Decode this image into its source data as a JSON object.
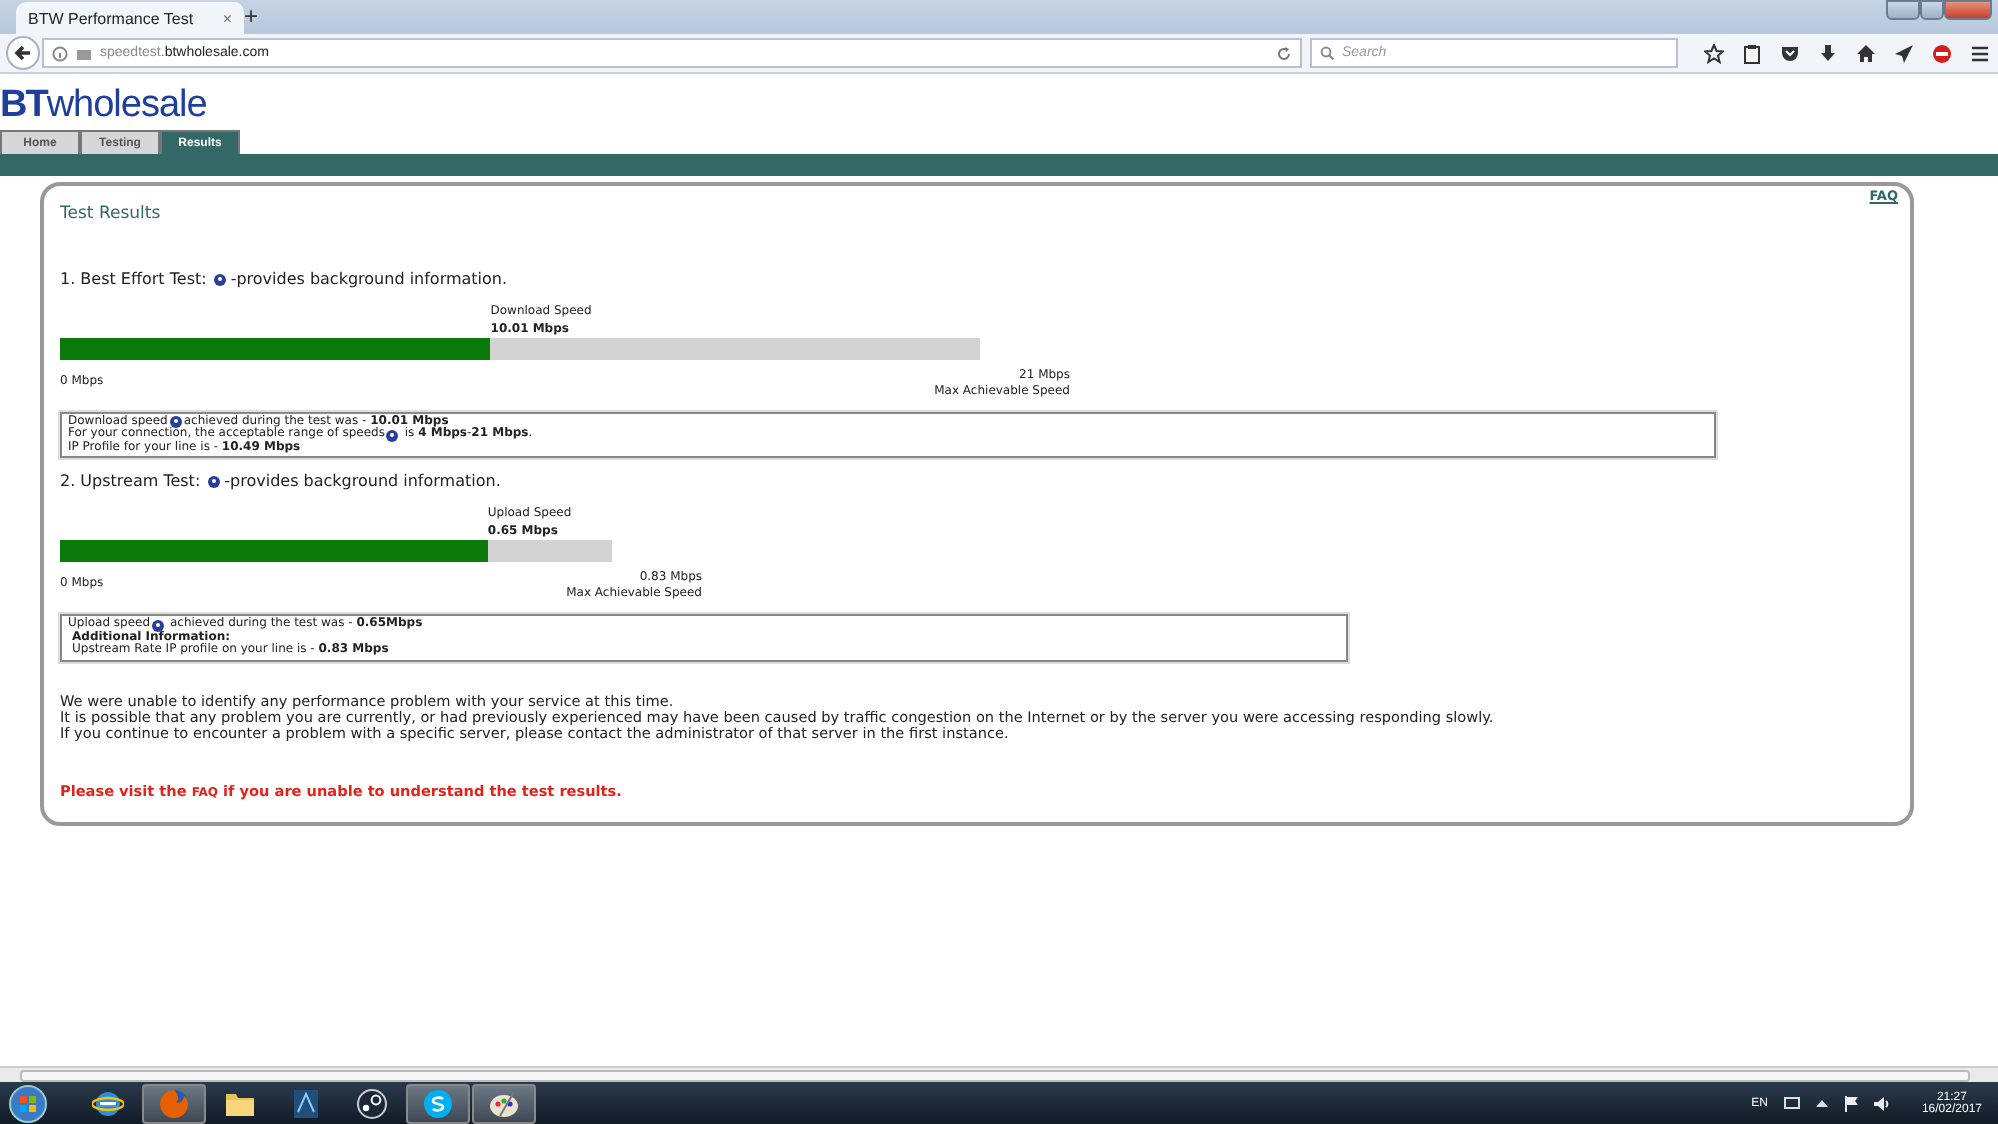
{
  "browser": {
    "tab_title": "BTW Performance Test",
    "close_tab": "×",
    "new_tab": "+",
    "url": "speedtest.**btwholesale.com**",
    "search_placeholder": "Search"
  },
  "site": {
    "logo_bold": "BT",
    "logo_rest": "wholesale",
    "nav_tabs": [
      {
        "label": "Home",
        "selected": false
      },
      {
        "label": "Testing",
        "selected": false
      },
      {
        "label": "Results",
        "selected": true
      }
    ]
  },
  "panel": {
    "faq_link": "FAQ",
    "title": "Test Results",
    "tests": [
      {
        "heading": "1. Best Effort Test:",
        "note": "-provides background information.",
        "meter_label": "Download  Speed",
        "meter_value": "10.01 Mbps",
        "level": 0.468,
        "min": "0 Mbps",
        "max": "21 Mbps",
        "max_label": "Max Achievable Speed",
        "info_lines": [
          {
            "before": "Download speed",
            "help_icon": true,
            "after": "achieved during the test was - **10.01 Mbps**",
            "bold": false
          },
          {
            "before": "For your connection, the acceptable range of speeds",
            "help_icon": true,
            "after": " is **4 Mbps**-**21 Mbps**.",
            "bold": false
          },
          {
            "before": "IP Profile for your line is - **10.49 Mbps**",
            "help_icon": false,
            "bold": false
          }
        ]
      },
      {
        "heading": "2. Upstream Test:",
        "note": "-provides background information.",
        "meter_label": "Upload Speed",
        "meter_value": "0.65 Mbps",
        "level": 0.775,
        "min": "0 Mbps",
        "max": "0.83 Mbps",
        "max_label": "Max Achievable Speed",
        "info_lines": [
          {
            "before": "Upload speed",
            "help_icon": true,
            "after": " achieved during the test was - **0.65Mbps**",
            "bold": false
          },
          {
            "before": "Additional Information:",
            "help_icon": false,
            "bold": true
          },
          {
            "before": "Upstream Rate IP profile on your line is - **0.83 Mbps**",
            "help_icon": false,
            "bold": false
          }
        ]
      }
    ],
    "messages": [
      "We were unable to identify any performance problem with your service at this time.",
      "It is possible that any problem you are currently, or had previously experienced may have been caused by traffic congestion on the Internet or by the server you were accessing responding slowly.",
      "If you continue to encounter a problem with a specific server, please contact the administrator of that server in the first instance."
    ],
    "notice_before": "Please visit the",
    "notice_link": "FAQ",
    "notice_after": "if you are unable to understand the test results."
  },
  "taskbar": {
    "items": [
      {
        "kind": "ie",
        "running": false
      },
      {
        "kind": "firefox",
        "running": true
      },
      {
        "kind": "folder",
        "running": false
      },
      {
        "kind": "app",
        "running": false
      },
      {
        "kind": "steam",
        "running": false
      },
      {
        "kind": "skype",
        "running": true
      },
      {
        "kind": "paint",
        "running": true
      }
    ],
    "language": "EN",
    "time": "21:27",
    "date": "16/02/2017"
  }
}
